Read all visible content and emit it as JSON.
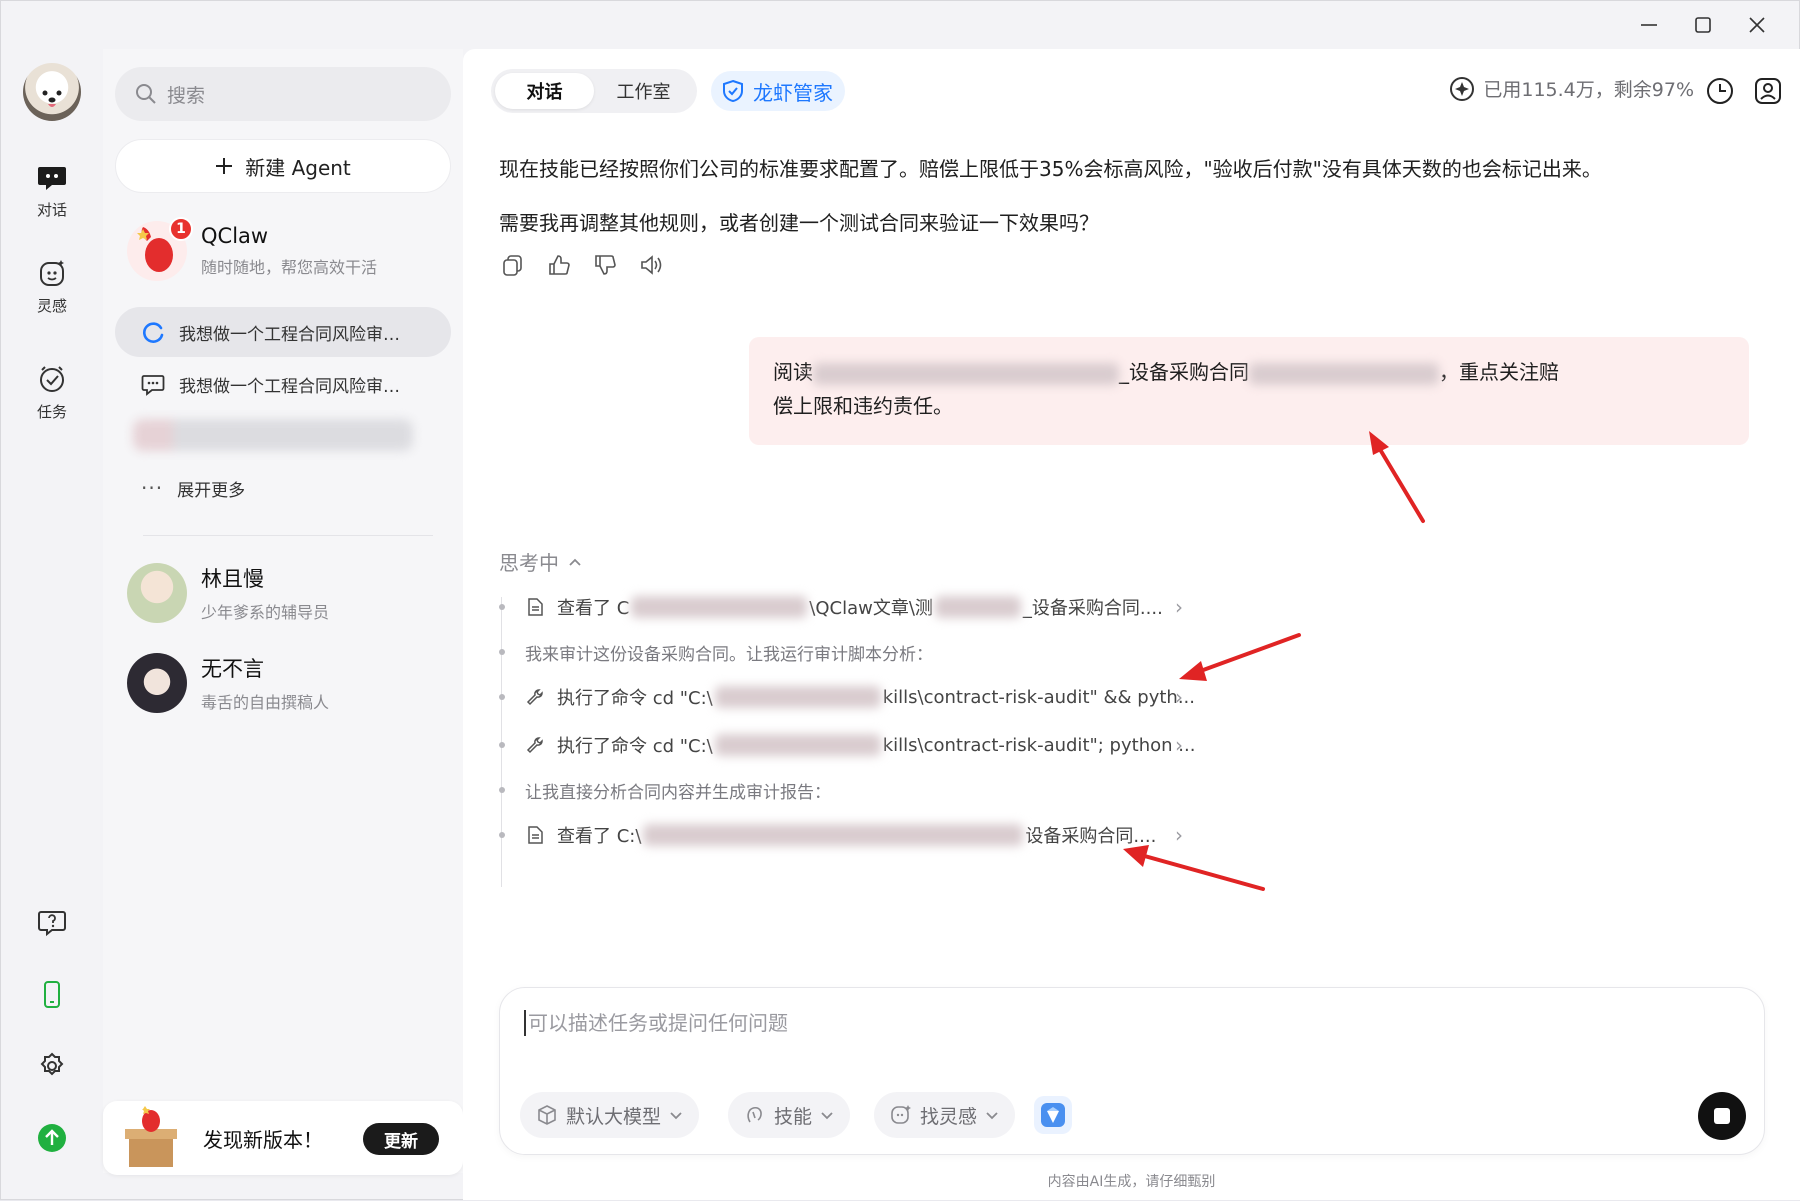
{
  "rail": {
    "items": [
      {
        "label": "对话"
      },
      {
        "label": "灵感"
      },
      {
        "label": "任务"
      }
    ]
  },
  "sidebar": {
    "search_placeholder": "搜索",
    "new_agent": "新建 Agent",
    "agents": [
      {
        "name": "QClaw",
        "sub": "随时随地，帮您高效干活",
        "badge": "1"
      },
      {
        "name": "林且慢",
        "sub": "少年爹系的辅导员"
      },
      {
        "name": "无不言",
        "sub": "毒舌的自由撰稿人"
      }
    ],
    "conversations": [
      {
        "title": "我想做一个工程合同风险审…"
      },
      {
        "title": "我想做一个工程合同风险审…"
      }
    ],
    "more": "展开更多",
    "update": {
      "text": "发现新版本！",
      "button": "更新"
    }
  },
  "header": {
    "tabs": [
      "对话",
      "工作室"
    ],
    "active_tab": "对话",
    "steward": "龙虾管家",
    "usage": "已用115.4万，剩余97%"
  },
  "chat": {
    "assistant_lines": [
      "现在技能已经按照你们公司的标准要求配置了。赔偿上限低于35%会标高风险，\"验收后付款\"没有具体天数的也会标记出来。",
      "需要我再调整其他规则，或者创建一个测试合同来验证一下效果吗？"
    ],
    "user_message": {
      "prefix": "阅读",
      "middle": "_设备采购合同",
      "suffix": "，重点关注赔",
      "line2": "偿上限和违约责任。"
    },
    "thinking": {
      "header": "思考中",
      "steps": [
        {
          "kind": "file",
          "text_a": "查看了 C",
          "text_b": "\\QClaw文章\\测",
          "text_c": "_设备采购合同...."
        },
        {
          "kind": "note",
          "text_a": "我来审计这份设备采购合同。让我运行审计脚本分析："
        },
        {
          "kind": "tool",
          "text_a": "执行了命令 cd \"C:\\",
          "text_b": "kills\\contract-risk-audit\" && pyth..."
        },
        {
          "kind": "tool",
          "text_a": "执行了命令 cd \"C:\\",
          "text_b": "kills\\contract-risk-audit\"; python ..."
        },
        {
          "kind": "note",
          "text_a": "让我直接分析合同内容并生成审计报告："
        },
        {
          "kind": "file",
          "text_a": "查看了 C:\\",
          "text_b": "设备采购合同...."
        }
      ]
    }
  },
  "composer": {
    "placeholder": "可以描述任务或提问任何问题",
    "chips": [
      "默认大模型",
      "技能",
      "找灵感"
    ],
    "disclaimer": "内容由AI生成，请仔细甄别"
  },
  "colors": {
    "accent_blue": "#1e78ff",
    "badge_red": "#e8322e",
    "annotation_red": "#e02424",
    "user_bubble": "#fdeeee",
    "green": "#20b040"
  }
}
